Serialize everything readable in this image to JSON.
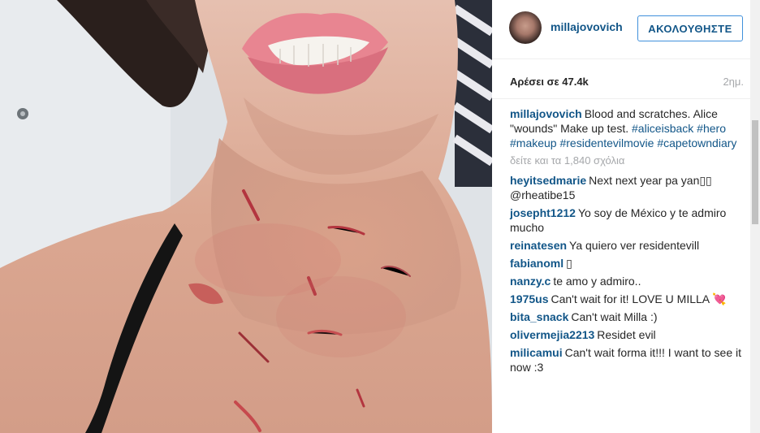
{
  "header": {
    "username": "millajovovich",
    "follow_label": "ΑΚΟΛΟΥΘΗΣΤΕ"
  },
  "stats": {
    "likes": "Αρέσει σε 47.4k",
    "time": "2ημ."
  },
  "caption": {
    "user": "millajovovich",
    "text": "Blood and scratches. Alice \"wounds\" Make up test.",
    "tags": [
      "#aliceisback",
      "#hero",
      "#makeup",
      "#residentevilmovie",
      "#capetowndiary"
    ]
  },
  "view_all_comments": "δείτε και τα 1,840 σχόλια",
  "comments": [
    {
      "user": "heyitsedmarie",
      "text": "Next next year pa yan▯▯ @rheatibe15"
    },
    {
      "user": "josepht1212",
      "text": "Yo soy de México y te admiro mucho"
    },
    {
      "user": "reinatesen",
      "text": "Ya quiero ver residentevill"
    },
    {
      "user": "fabianoml",
      "text": "▯"
    },
    {
      "user": "nanzy.c",
      "text": "te amo y admiro.."
    },
    {
      "user": "1975us",
      "text": "Can't wait for it! LOVE U MILLA 💘"
    },
    {
      "user": "bita_snack",
      "text": "Can't wait Milla :)"
    },
    {
      "user": "olivermejia2213",
      "text": "Residet evil"
    },
    {
      "user": "milicamui",
      "text": "Can't wait forma it!!! I want to see it now :3"
    }
  ],
  "colors": {
    "link": "#125688",
    "muted": "#a5a7aa",
    "follow_border": "#4090db"
  },
  "icons": {
    "avatar": "avatar-image"
  }
}
